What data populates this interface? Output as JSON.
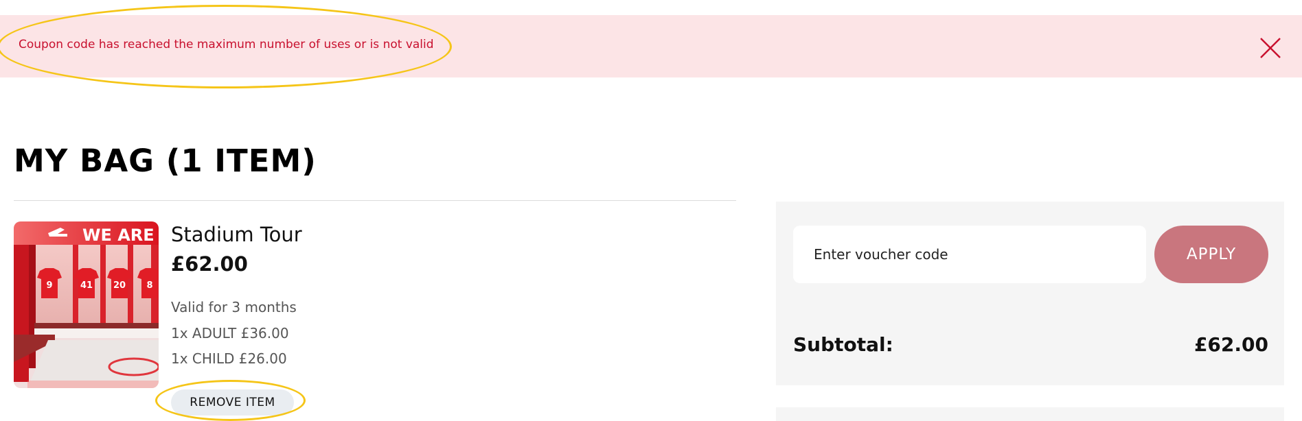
{
  "alert": {
    "message": "Coupon code has reached the maximum number of uses or is not valid",
    "close_icon": "close-icon",
    "color": "#c8102e",
    "background": "#fce4e6"
  },
  "bag": {
    "title": "MY BAG (1 ITEM)"
  },
  "item": {
    "name": "Stadium Tour",
    "price": "£62.00",
    "validity": "Valid for 3 months",
    "adult": "1x ADULT £36.00",
    "child": "1x CHILD £26.00",
    "remove_label": "REMOVE ITEM",
    "image": {
      "banner_text": "WE ARE TH",
      "shirt_numbers": [
        "9",
        "41",
        "20",
        "8"
      ]
    }
  },
  "summary": {
    "voucher_placeholder": "Enter voucher code",
    "voucher_value": "",
    "apply_label": "APPLY",
    "apply_color": "#c9767e",
    "subtotal_label": "Subtotal:",
    "subtotal_value": "£62.00"
  },
  "annotations": {
    "highlight_color": "#f5c518"
  }
}
